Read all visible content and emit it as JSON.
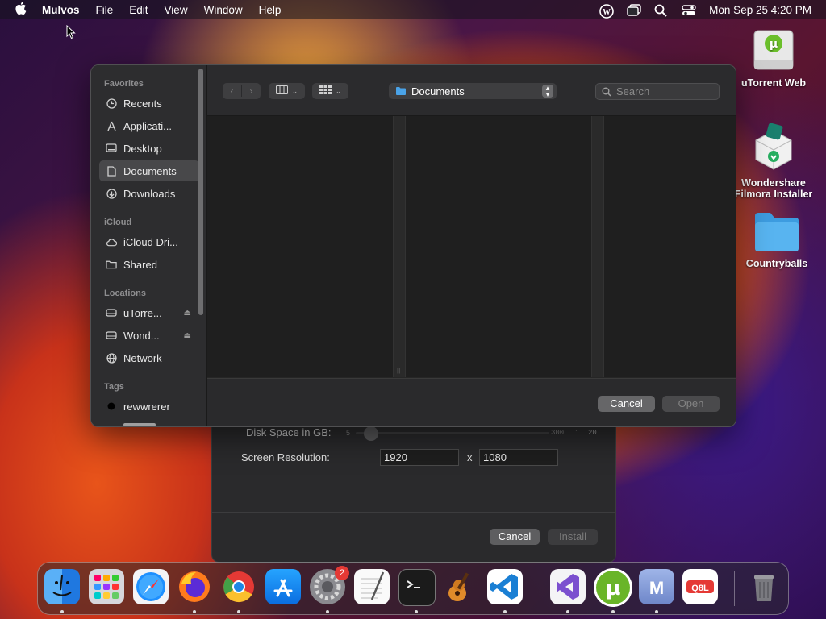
{
  "menubar": {
    "app": "Mulvos",
    "menus": [
      "File",
      "Edit",
      "View",
      "Window",
      "Help"
    ],
    "clock": "Mon Sep 25  4:20 PM"
  },
  "desktop": {
    "icons": [
      {
        "label": "uTorrent Web"
      },
      {
        "label": "Wondershare Filmora Installer"
      },
      {
        "label": "Countryballs"
      }
    ]
  },
  "background_window": {
    "disk_label": "Disk Space in GB:",
    "disk_min": "5",
    "disk_max": "300",
    "disk_sep": ":",
    "disk_value": "20",
    "resolution_label": "Screen Resolution:",
    "res_width": "1920",
    "res_x": "x",
    "res_height": "1080",
    "cancel": "Cancel",
    "install": "Install"
  },
  "dialog": {
    "sidebar": {
      "favorites_head": "Favorites",
      "icloud_head": "iCloud",
      "locations_head": "Locations",
      "tags_head": "Tags",
      "items": {
        "recents": "Recents",
        "applications": "Applicati...",
        "desktop": "Desktop",
        "documents": "Documents",
        "downloads": "Downloads",
        "icloud_drive": "iCloud Dri...",
        "shared": "Shared",
        "utorrent": "uTorre...",
        "wondershare": "Wond...",
        "network": "Network",
        "tag1": "rewwrerer"
      }
    },
    "path": "Documents",
    "search_placeholder": "Search",
    "cancel": "Cancel",
    "open": "Open"
  },
  "dock": {
    "settings_badge": "2"
  },
  "colors": {
    "accent": "#3a8ee6",
    "folder_blue": "#4aa3e8",
    "badge_red": "#e53935"
  }
}
